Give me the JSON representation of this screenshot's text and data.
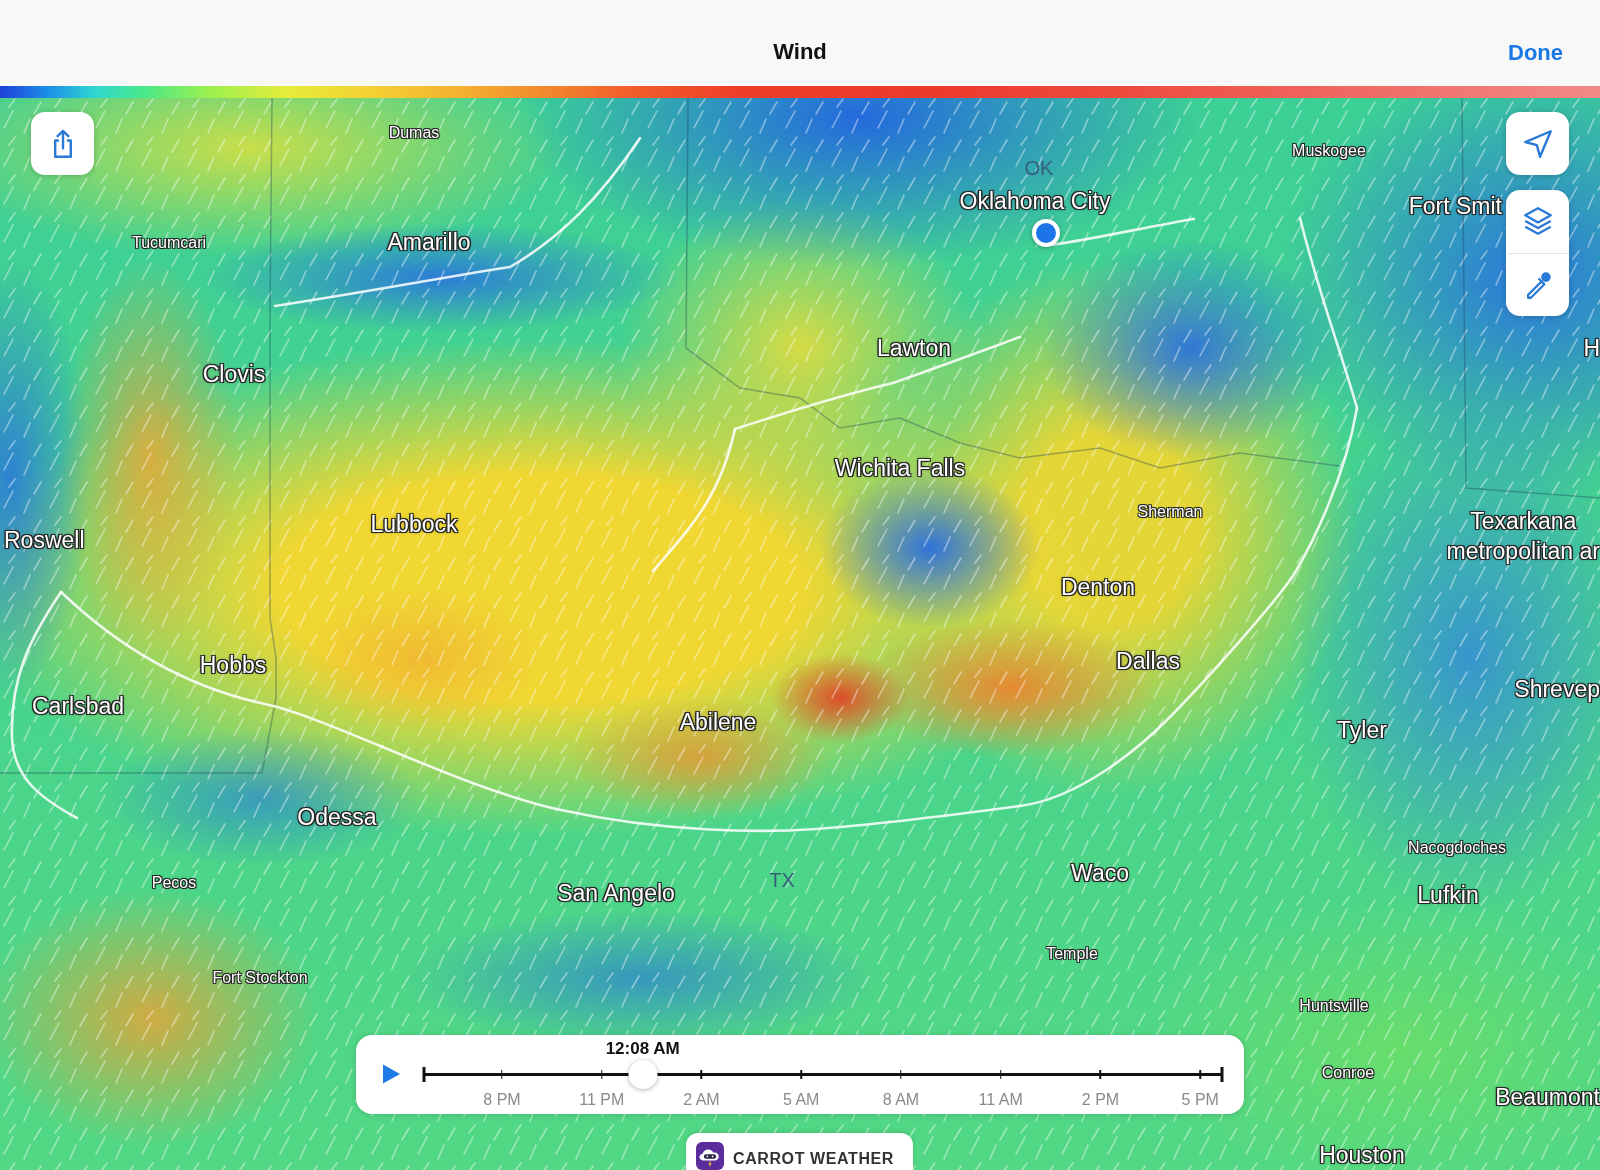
{
  "nav_bar": {
    "title": "Wind",
    "done": "Done"
  },
  "map": {
    "labels": [
      {
        "text": "Dumas",
        "kind": "town"
      },
      {
        "text": "Muskogee",
        "kind": "town"
      },
      {
        "text": "OK",
        "kind": "state"
      },
      {
        "text": "Oklahoma City",
        "kind": "city"
      },
      {
        "text": "Fort Smit",
        "kind": "city"
      },
      {
        "text": "Tucumcari",
        "kind": "town"
      },
      {
        "text": "Amarillo",
        "kind": "city"
      },
      {
        "text": "Lawton",
        "kind": "city"
      },
      {
        "text": "H",
        "kind": "city"
      },
      {
        "text": "Clovis",
        "kind": "city"
      },
      {
        "text": "Wichita Falls",
        "kind": "city"
      },
      {
        "text": "Roswell",
        "kind": "city"
      },
      {
        "text": "Lubbock",
        "kind": "city"
      },
      {
        "text": "Sherman",
        "kind": "town"
      },
      {
        "text": "Texarkana\nmetropolitan ar",
        "kind": "city"
      },
      {
        "text": "Denton",
        "kind": "city"
      },
      {
        "text": "Hobbs",
        "kind": "city"
      },
      {
        "text": "Dallas",
        "kind": "city"
      },
      {
        "text": "Shrevep",
        "kind": "city"
      },
      {
        "text": "Carlsbad",
        "kind": "city"
      },
      {
        "text": "Abilene",
        "kind": "city"
      },
      {
        "text": "Tyler",
        "kind": "city"
      },
      {
        "text": "Odessa",
        "kind": "city"
      },
      {
        "text": "Nacogdoches",
        "kind": "town"
      },
      {
        "text": "Pecos",
        "kind": "town"
      },
      {
        "text": "San Angelo",
        "kind": "city"
      },
      {
        "text": "TX",
        "kind": "state"
      },
      {
        "text": "Waco",
        "kind": "city"
      },
      {
        "text": "Lufkin",
        "kind": "city"
      },
      {
        "text": "Temple",
        "kind": "town"
      },
      {
        "text": "Fort Stockton",
        "kind": "town"
      },
      {
        "text": "Huntsville",
        "kind": "town"
      },
      {
        "text": "Conroe",
        "kind": "town"
      },
      {
        "text": "Beaumont",
        "kind": "city"
      },
      {
        "text": "Houston",
        "kind": "city"
      }
    ]
  },
  "timeline": {
    "current_time": "12:08 AM",
    "level": 0.274,
    "ticks": [
      "8 PM",
      "11 PM",
      "2 AM",
      "5 AM",
      "8 AM",
      "11 AM",
      "2 PM",
      "5 PM"
    ]
  },
  "brand": {
    "name": "CARROT WEATHER"
  }
}
